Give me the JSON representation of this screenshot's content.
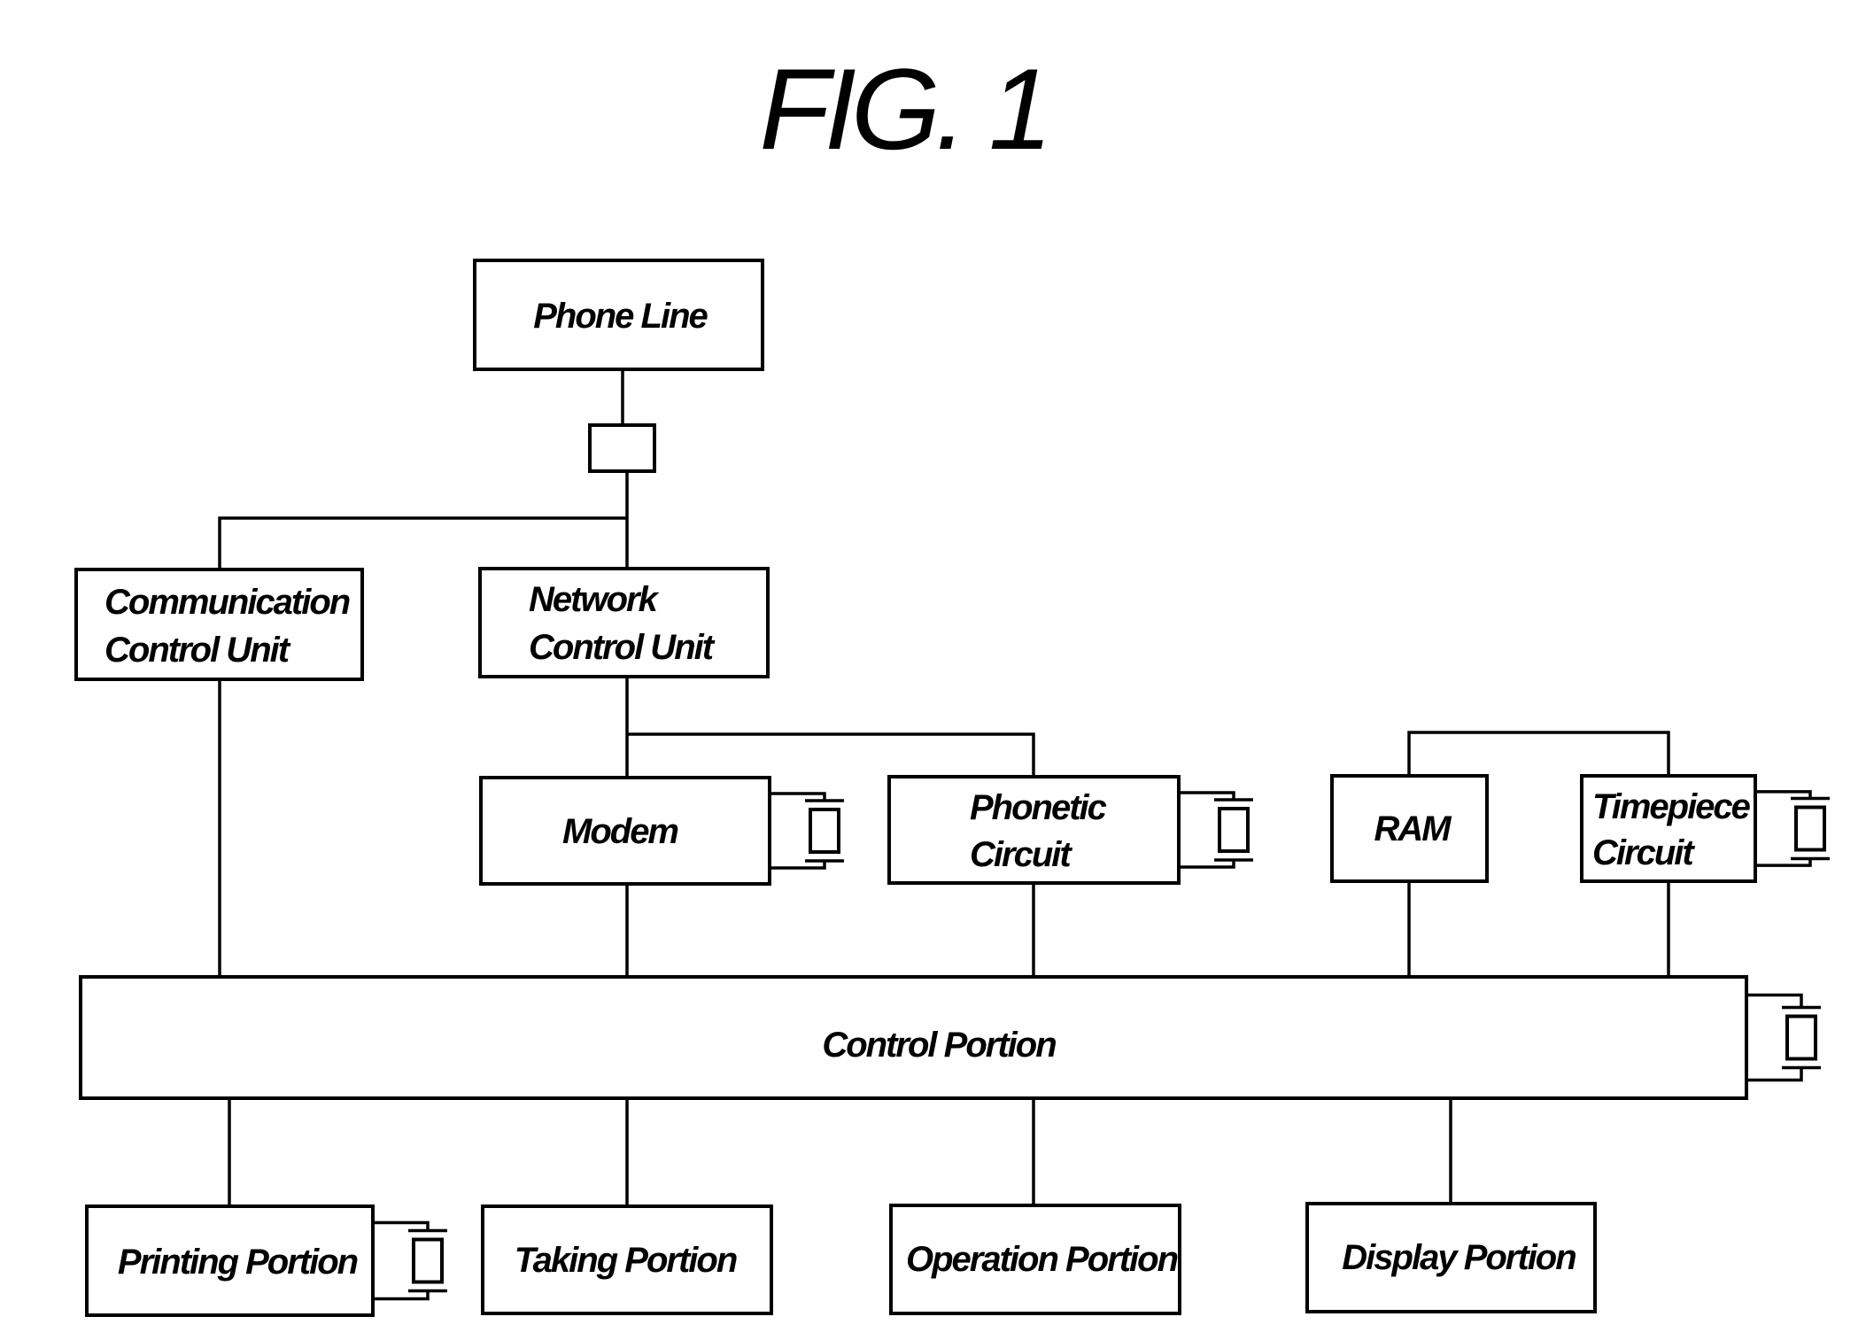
{
  "figure": {
    "title": "FIG. 1",
    "ink_color": "#000000",
    "background_color": "#ffffff"
  },
  "blocks": {
    "phone_line": {
      "lines": [
        "Phone Line"
      ],
      "has_oscillator": false
    },
    "line_connector": {
      "lines": [],
      "has_oscillator": false
    },
    "communication_control_unit": {
      "lines": [
        "Communication",
        "Control Unit"
      ],
      "has_oscillator": false
    },
    "network_control_unit": {
      "lines": [
        "Network",
        "Control Unit"
      ],
      "has_oscillator": false
    },
    "modem": {
      "lines": [
        "Modem"
      ],
      "has_oscillator": true
    },
    "phonetic_circuit": {
      "lines": [
        "Phonetic",
        "Circuit"
      ],
      "has_oscillator": true
    },
    "ram": {
      "lines": [
        "RAM"
      ],
      "has_oscillator": false
    },
    "timepiece_circuit": {
      "lines": [
        "Timepiece",
        "Circuit"
      ],
      "has_oscillator": true
    },
    "control_portion": {
      "lines": [
        "Control Portion"
      ],
      "has_oscillator": true
    },
    "printing_portion": {
      "lines": [
        "Printing Portion"
      ],
      "has_oscillator": true
    },
    "taking_portion": {
      "lines": [
        "Taking Portion"
      ],
      "has_oscillator": false
    },
    "operation_portion": {
      "lines": [
        "Operation Portion"
      ],
      "has_oscillator": false
    },
    "display_portion": {
      "lines": [
        "Display Portion"
      ],
      "has_oscillator": false
    }
  },
  "connections": [
    [
      "phone_line",
      "line_connector"
    ],
    [
      "line_connector",
      "communication_control_unit"
    ],
    [
      "line_connector",
      "network_control_unit"
    ],
    [
      "network_control_unit",
      "modem"
    ],
    [
      "network_control_unit",
      "phonetic_circuit"
    ],
    [
      "ram",
      "timepiece_circuit"
    ],
    [
      "communication_control_unit",
      "control_portion"
    ],
    [
      "modem",
      "control_portion"
    ],
    [
      "phonetic_circuit",
      "control_portion"
    ],
    [
      "ram",
      "control_portion"
    ],
    [
      "timepiece_circuit",
      "control_portion"
    ],
    [
      "control_portion",
      "printing_portion"
    ],
    [
      "control_portion",
      "taking_portion"
    ],
    [
      "control_portion",
      "operation_portion"
    ],
    [
      "control_portion",
      "display_portion"
    ]
  ]
}
